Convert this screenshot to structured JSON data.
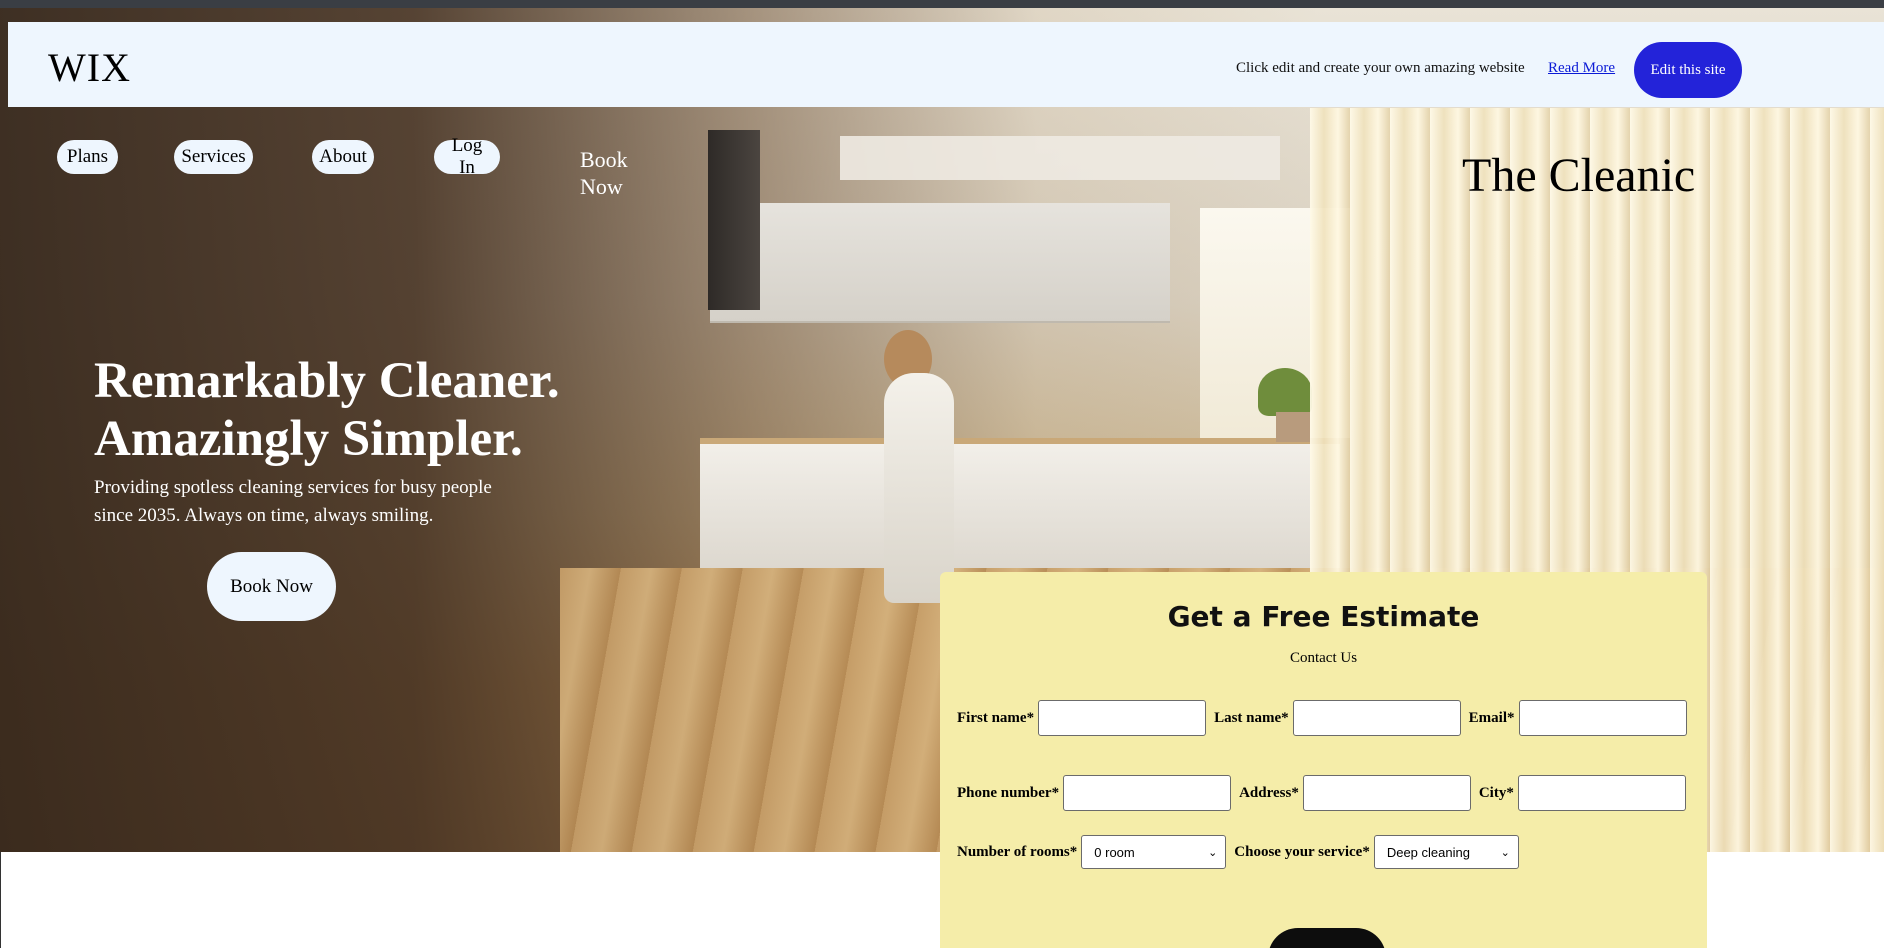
{
  "wix_banner": {
    "logo": "WIX",
    "message": "Click edit and create your own amazing website",
    "read_more": "Read More",
    "edit_button": "Edit this site"
  },
  "nav": {
    "items": [
      {
        "label": "Plans"
      },
      {
        "label": "Services"
      },
      {
        "label": "About"
      },
      {
        "label": "Log In"
      }
    ],
    "book_now": "Book Now"
  },
  "brand": "The Cleanic",
  "hero": {
    "title_line1": "Remarkably Cleaner.",
    "title_line2": "Amazingly Simpler.",
    "subtitle": "Providing spotless cleaning services for busy people since 2035. Always on time, always smiling.",
    "cta": "Book Now"
  },
  "estimate": {
    "title": "Get a Free Estimate",
    "subtitle": "Contact Us",
    "fields": {
      "first_name": {
        "label": "First name*",
        "value": ""
      },
      "last_name": {
        "label": "Last name*",
        "value": ""
      },
      "email": {
        "label": "Email*",
        "value": ""
      },
      "phone": {
        "label": "Phone number*",
        "value": ""
      },
      "address": {
        "label": "Address*",
        "value": ""
      },
      "city": {
        "label": "City*",
        "value": ""
      }
    },
    "rooms": {
      "label": "Number of rooms*",
      "selected": "0 room"
    },
    "service": {
      "label": "Choose your service*",
      "selected": "Deep cleaning"
    },
    "submit_label": ""
  },
  "colors": {
    "banner_bg": "#eef6fe",
    "edit_button": "#2323d9",
    "link": "#0b1ad6",
    "estimate_bg": "#f5eda9",
    "submit_bg": "#0d0d0d"
  }
}
